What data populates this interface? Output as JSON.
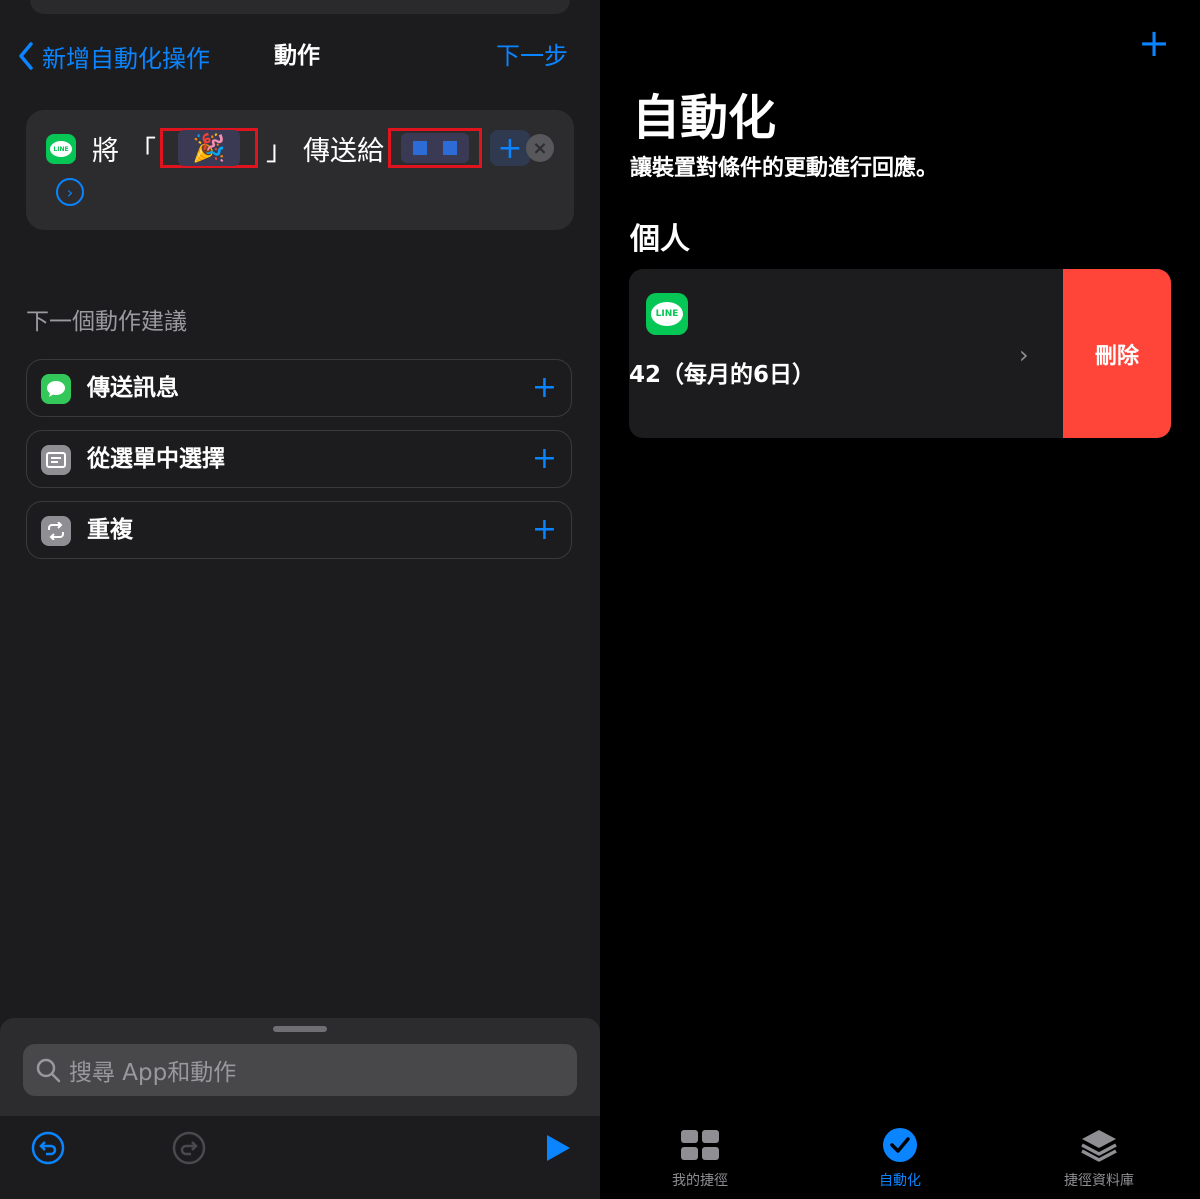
{
  "left": {
    "nav": {
      "back_label": "新增自動化操作",
      "title": "動作",
      "next_label": "下一步"
    },
    "action": {
      "verb": "將",
      "open_quote": "「",
      "message_emoji": "🎉",
      "close_quote": "」",
      "send_to": "傳送給",
      "add_symbol": "+",
      "clear_symbol": "×",
      "expand_symbol": "›"
    },
    "suggestions": {
      "header": "下一個動作建議",
      "items": [
        {
          "label": "傳送訊息",
          "icon": "message-bubble-icon",
          "color": "#34c759"
        },
        {
          "label": "從選單中選擇",
          "icon": "menu-list-icon",
          "color": "#8e8e93"
        },
        {
          "label": "重複",
          "icon": "repeat-icon",
          "color": "#8e8e93"
        }
      ],
      "add_symbol": "+"
    },
    "search": {
      "placeholder": "搜尋 App和動作"
    }
  },
  "right": {
    "add_symbol": "+",
    "title": "自動化",
    "subtitle": "讓裝置對條件的更動進行回應。",
    "section": "個人",
    "automation": {
      "label": "42（每月的6日）",
      "app_icon": "line-app-icon",
      "app_icon_text": "LINE",
      "chevron": "›",
      "delete_label": "刪除"
    },
    "tabs": [
      {
        "label": "我的捷徑",
        "icon": "grid-icon",
        "active": false
      },
      {
        "label": "自動化",
        "icon": "automation-check-icon",
        "active": true
      },
      {
        "label": "捷徑資料庫",
        "icon": "layers-icon",
        "active": false
      }
    ]
  },
  "colors": {
    "accent": "#0a84ff",
    "delete": "#ff453a",
    "line_green": "#06c755",
    "annotation_red": "#e0141e"
  }
}
